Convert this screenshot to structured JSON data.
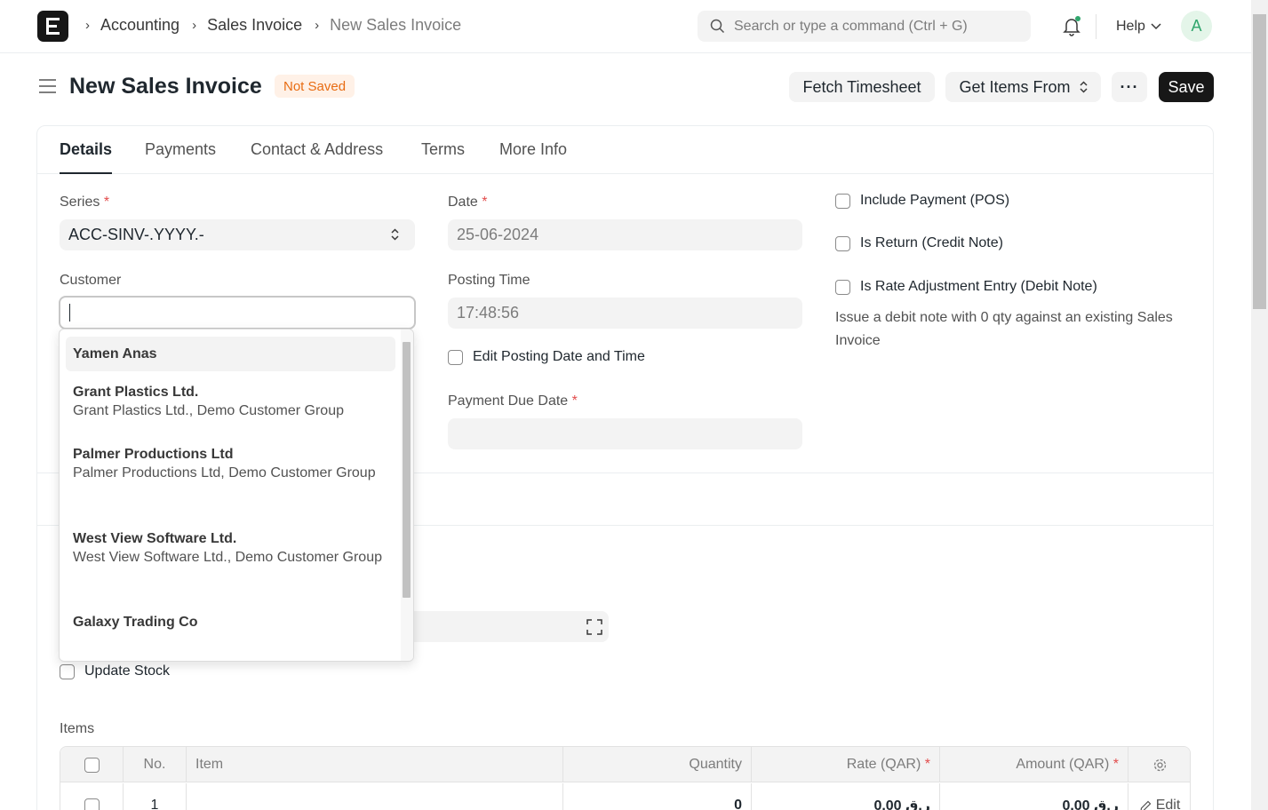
{
  "breadcrumbs": [
    "Accounting",
    "Sales Invoice",
    "New Sales Invoice"
  ],
  "search": {
    "placeholder": "Search or type a command (Ctrl + G)"
  },
  "help_label": "Help",
  "avatar_initial": "A",
  "page": {
    "title": "New Sales Invoice",
    "status": "Not Saved",
    "buttons": {
      "fetch": "Fetch Timesheet",
      "get_items": "Get Items From",
      "more": "···",
      "save": "Save"
    }
  },
  "tabs": [
    "Details",
    "Payments",
    "Contact & Address",
    "Terms",
    "More Info"
  ],
  "form": {
    "series_label": "Series",
    "series_value": "ACC-SINV-.YYYY.-",
    "customer_label": "Customer",
    "customer_value": "",
    "date_label": "Date",
    "date_value": "25-06-2024",
    "posting_time_label": "Posting Time",
    "posting_time_value": "17:48:56",
    "edit_posting_label": "Edit Posting Date and Time",
    "payment_due_label": "Payment Due Date",
    "payment_due_value": "",
    "include_payment_label": "Include Payment (POS)",
    "is_return_label": "Is Return (Credit Note)",
    "rate_adjustment_label": "Is Rate Adjustment Entry (Debit Note)",
    "rate_adjustment_help": "Issue a debit note with 0 qty against an existing Sales Invoice",
    "update_stock_label": "Update Stock",
    "required_mark": "*"
  },
  "dropdown": {
    "items": [
      {
        "title": "Yamen Anas",
        "sub": ""
      },
      {
        "title": "Grant Plastics Ltd.",
        "sub": "Grant Plastics Ltd., Demo Customer Group"
      },
      {
        "title": "Palmer Productions Ltd",
        "sub": "Palmer Productions Ltd, Demo Customer Group"
      },
      {
        "title": "West View Software Ltd.",
        "sub": "West View Software Ltd., Demo Customer Group"
      },
      {
        "title": "Galaxy Trading Co",
        "sub": ""
      }
    ]
  },
  "items_table": {
    "label": "Items",
    "headers": {
      "no": "No.",
      "item": "Item",
      "quantity": "Quantity",
      "rate": "Rate (QAR)",
      "amount": "Amount (QAR)"
    },
    "rows": [
      {
        "no": "1",
        "item": "",
        "quantity": "0",
        "rate": "0.00 ر.ق",
        "amount": "0.00 ر.ق",
        "edit": "Edit"
      }
    ]
  }
}
